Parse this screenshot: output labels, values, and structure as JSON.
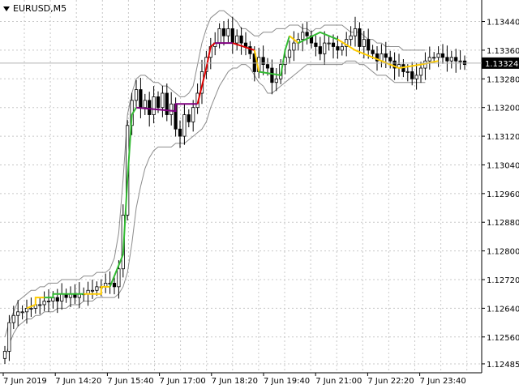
{
  "symbol": "EURUSD,M5",
  "current_price": "1.13324",
  "colors": {
    "background": "#ffffff",
    "grid": "#c8c8c8",
    "candle": "#000000",
    "band": "#8c8c8c",
    "green": "#33bb33",
    "yellow": "#ffcc00",
    "red": "#dd0000",
    "purple": "#800080",
    "price_line": "#b0b0b0",
    "price_label_bg": "#000000",
    "price_label_fg": "#ffffff"
  },
  "chart_data": {
    "type": "candlestick",
    "ylim": [
      1.1246,
      1.135
    ],
    "y_ticks": [
      "1.13440",
      "1.13360",
      "1.13280",
      "1.13200",
      "1.13120",
      "1.13040",
      "1.12960",
      "1.12880",
      "1.12800",
      "1.12720",
      "1.12640",
      "1.12560",
      "1.12485"
    ],
    "x_ticks": [
      "7 Jun 2019",
      "7 Jun 14:20",
      "7 Jun 15:40",
      "7 Jun 17:00",
      "7 Jun 18:20",
      "7 Jun 19:40",
      "7 Jun 21:00",
      "7 Jun 22:20",
      "7 Jun 23:40"
    ],
    "close": [
      1.1252,
      1.126,
      1.1262,
      1.1263,
      1.1263,
      1.1264,
      1.1264,
      1.1265,
      1.1265,
      1.1266,
      1.1266,
      1.1267,
      1.1266,
      1.1268,
      1.1267,
      1.1268,
      1.1267,
      1.1268,
      1.1268,
      1.1269,
      1.1269,
      1.127,
      1.127,
      1.1271,
      1.1271,
      1.127,
      1.1275,
      1.129,
      1.1315,
      1.1322,
      1.1325,
      1.132,
      1.1322,
      1.1318,
      1.1323,
      1.132,
      1.1324,
      1.1318,
      1.1321,
      1.1314,
      1.1312,
      1.1318,
      1.1316,
      1.132,
      1.1324,
      1.133,
      1.1334,
      1.1337,
      1.1338,
      1.1342,
      1.134,
      1.1342,
      1.1338,
      1.134,
      1.1338,
      1.1337,
      1.1335,
      1.133,
      1.1334,
      1.1332,
      1.1331,
      1.1327,
      1.1328,
      1.1332,
      1.1334,
      1.1336,
      1.1338,
      1.1339,
      1.1341,
      1.134,
      1.1338,
      1.1337,
      1.1335,
      1.1338,
      1.1338,
      1.1337,
      1.1336,
      1.1337,
      1.1339,
      1.134,
      1.1342,
      1.1337,
      1.1339,
      1.1336,
      1.1335,
      1.1333,
      1.1335,
      1.1334,
      1.1333,
      1.1331,
      1.1332,
      1.133,
      1.133,
      1.1328,
      1.1329,
      1.1331,
      1.1333,
      1.1334,
      1.1334,
      1.1335,
      1.1334,
      1.1333,
      1.1334,
      1.1333,
      1.1333,
      1.1332
    ],
    "series": [
      {
        "name": "upper_band",
        "values": [
          1.1256,
          1.126,
          1.1263,
          1.1266,
          1.1267,
          1.1268,
          1.1269,
          1.1269,
          1.127,
          1.127,
          1.1271,
          1.1271,
          1.1271,
          1.1272,
          1.1272,
          1.1272,
          1.1272,
          1.1272,
          1.1273,
          1.1273,
          1.1273,
          1.1274,
          1.1274,
          1.1274,
          1.1275,
          1.1278,
          1.1285,
          1.13,
          1.1318,
          1.1324,
          1.1328,
          1.1329,
          1.1329,
          1.1328,
          1.1327,
          1.1327,
          1.1326,
          1.1326,
          1.1325,
          1.1324,
          1.1323,
          1.1323,
          1.1324,
          1.1326,
          1.1332,
          1.1338,
          1.1342,
          1.1345,
          1.1346,
          1.1347,
          1.1347,
          1.1346,
          1.1345,
          1.1344,
          1.1342,
          1.1342,
          1.1341,
          1.134,
          1.134,
          1.1341,
          1.1341,
          1.1341,
          1.1342,
          1.1342,
          1.1342,
          1.1343,
          1.1343,
          1.1343,
          1.1342,
          1.1342,
          1.1341,
          1.1342,
          1.1342,
          1.1343,
          1.1343,
          1.1343,
          1.1343,
          1.1343,
          1.1342,
          1.1341,
          1.1341,
          1.1341,
          1.134,
          1.1339,
          1.1339,
          1.1338,
          1.1338,
          1.1337,
          1.1337,
          1.1337,
          1.1337,
          1.1336,
          1.1336,
          1.1336,
          1.1336,
          1.1336,
          1.1336
        ]
      },
      {
        "name": "lower_band",
        "values": [
          1.125,
          1.1254,
          1.1257,
          1.1259,
          1.126,
          1.1261,
          1.1261,
          1.1262,
          1.1262,
          1.1263,
          1.1263,
          1.1263,
          1.1264,
          1.1264,
          1.1264,
          1.1265,
          1.1265,
          1.1265,
          1.1266,
          1.1266,
          1.1266,
          1.1267,
          1.1267,
          1.1267,
          1.1267,
          1.1267,
          1.1268,
          1.127,
          1.1274,
          1.1282,
          1.1292,
          1.1298,
          1.1303,
          1.1306,
          1.1308,
          1.1309,
          1.1309,
          1.1309,
          1.1309,
          1.131,
          1.131,
          1.131,
          1.1311,
          1.1312,
          1.1313,
          1.1314,
          1.1316,
          1.132,
          1.1323,
          1.1326,
          1.1328,
          1.133,
          1.1331,
          1.1331,
          1.1332,
          1.1332,
          1.1331,
          1.1329,
          1.1327,
          1.1326,
          1.1324,
          1.1324,
          1.1325,
          1.1326,
          1.1327,
          1.1328,
          1.1329,
          1.133,
          1.1331,
          1.1332,
          1.1332,
          1.1332,
          1.1332,
          1.1332,
          1.1332,
          1.1332,
          1.1332,
          1.1332,
          1.1333,
          1.1333,
          1.1333,
          1.1332,
          1.1332,
          1.1331,
          1.133,
          1.1329,
          1.1329,
          1.1329,
          1.1328,
          1.1327,
          1.1327,
          1.1327,
          1.1327,
          1.1327,
          1.1327,
          1.1327,
          1.1327
        ]
      }
    ],
    "step_segments": [
      {
        "color": "yellow",
        "points": [
          [
            5,
            1.1264
          ],
          [
            7,
            1.1265
          ],
          [
            7,
            1.1267
          ],
          [
            9,
            1.1267
          ]
        ]
      },
      {
        "color": "green",
        "points": [
          [
            9,
            1.1267
          ],
          [
            11,
            1.1267
          ],
          [
            11,
            1.1268
          ],
          [
            18,
            1.1268
          ]
        ]
      },
      {
        "color": "yellow",
        "points": [
          [
            18,
            1.1268
          ],
          [
            22,
            1.1268
          ],
          [
            22,
            1.127
          ],
          [
            24,
            1.127
          ]
        ]
      },
      {
        "color": "green",
        "points": [
          [
            24,
            1.127
          ],
          [
            27,
            1.1279
          ],
          [
            28,
            1.13
          ],
          [
            29,
            1.1318
          ],
          [
            30,
            1.132
          ]
        ]
      },
      {
        "color": "purple",
        "points": [
          [
            30,
            1.132
          ],
          [
            39,
            1.1319
          ],
          [
            39,
            1.1321
          ],
          [
            44,
            1.1321
          ]
        ]
      },
      {
        "color": "red",
        "points": [
          [
            44,
            1.1321
          ],
          [
            46,
            1.1331
          ],
          [
            47,
            1.1337
          ],
          [
            48,
            1.1338
          ]
        ]
      },
      {
        "color": "purple",
        "points": [
          [
            48,
            1.1338
          ],
          [
            52,
            1.1338
          ]
        ]
      },
      {
        "color": "red",
        "points": [
          [
            52,
            1.1338
          ],
          [
            57,
            1.1336
          ]
        ]
      },
      {
        "color": "yellow",
        "points": [
          [
            57,
            1.1336
          ],
          [
            58,
            1.133
          ]
        ]
      },
      {
        "color": "green",
        "points": [
          [
            58,
            1.133
          ],
          [
            63,
            1.1329
          ],
          [
            64,
            1.1336
          ],
          [
            65,
            1.134
          ]
        ]
      },
      {
        "color": "yellow",
        "points": [
          [
            65,
            1.134
          ],
          [
            67,
            1.1338
          ]
        ]
      },
      {
        "color": "green",
        "points": [
          [
            67,
            1.1338
          ],
          [
            72,
            1.1341
          ],
          [
            76,
            1.1339
          ]
        ]
      },
      {
        "color": "yellow",
        "points": [
          [
            76,
            1.1339
          ],
          [
            80,
            1.1336
          ],
          [
            86,
            1.1333
          ],
          [
            90,
            1.1331
          ]
        ]
      },
      {
        "color": "yellow",
        "points": [
          [
            90,
            1.1331
          ],
          [
            95,
            1.1332
          ],
          [
            99,
            1.1333
          ]
        ]
      }
    ]
  }
}
